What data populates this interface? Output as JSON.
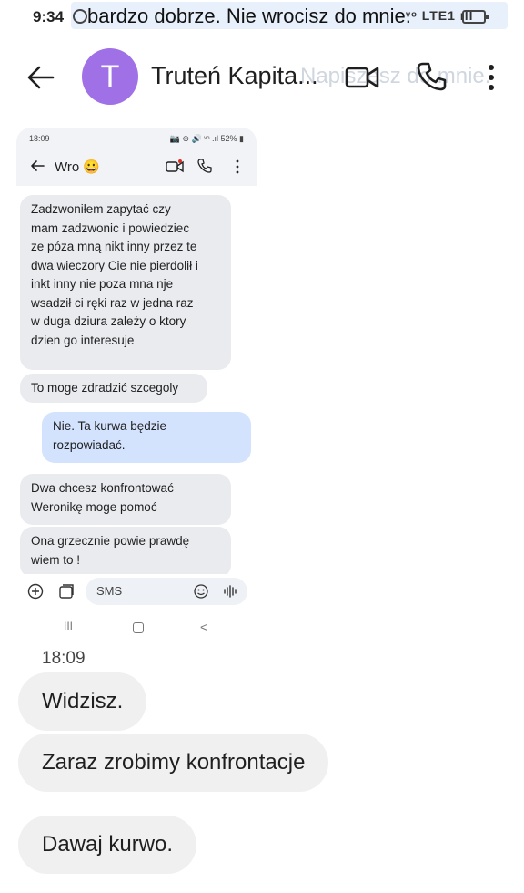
{
  "status_bar": {
    "time": "9:34",
    "notification_text": "bardzo dobrze. Nie wrocisz do mnie.",
    "icons_text": "ᵛᵒ LTE1 ıll"
  },
  "app_bar": {
    "contact_name": "Truteń Kapita...",
    "avatar_letter": "T",
    "ghost_text": "Napiszesz do mnie.",
    "avatar_color": "#a070e6"
  },
  "embedded": {
    "status_time": "18:09",
    "status_right": "📷 ⊕ 🔊 ᵛᵒ .ıl 52% ▮",
    "title": "Wro 😀",
    "messages": [
      {
        "text": "Zadzwoniłem zapytać czy\nmam zadzwonic i powiedziec\nze póza mną nikt inny przez te\ndwa wieczory Cie nie pierdolił i\ninkt inny nie poza mna nje\nwsadził ci ręki raz w jedna raz\nw duga dziura zależy o ktory\ndzien go interesuje",
        "dir": "in"
      },
      {
        "text": "To moge zdradzić szcegoly",
        "dir": "in"
      },
      {
        "text": "Nie. Ta kurwa będzie\nrozpowiadać.",
        "dir": "out"
      },
      {
        "text": "Dwa chcesz konfrontować\nWeronikę moge pomoć",
        "dir": "in"
      },
      {
        "text": "Ona grzecznie powie prawdę\nwiem to !",
        "dir": "in"
      }
    ],
    "compose_placeholder": "SMS",
    "nav": {
      "recent": "III",
      "back": "<"
    }
  },
  "conversation": {
    "timestamp": "18:09",
    "messages": [
      {
        "text": "Widzisz.",
        "dir": "in"
      },
      {
        "text": "Zaraz zrobimy konfrontacje",
        "dir": "in"
      },
      {
        "text": "Dawaj kurwo.",
        "dir": "in"
      }
    ]
  },
  "colors": {
    "incoming_bubble": "#f0f0f1",
    "outgoing_bubble": "#d3e3fd",
    "accent": "#1a73e8"
  }
}
